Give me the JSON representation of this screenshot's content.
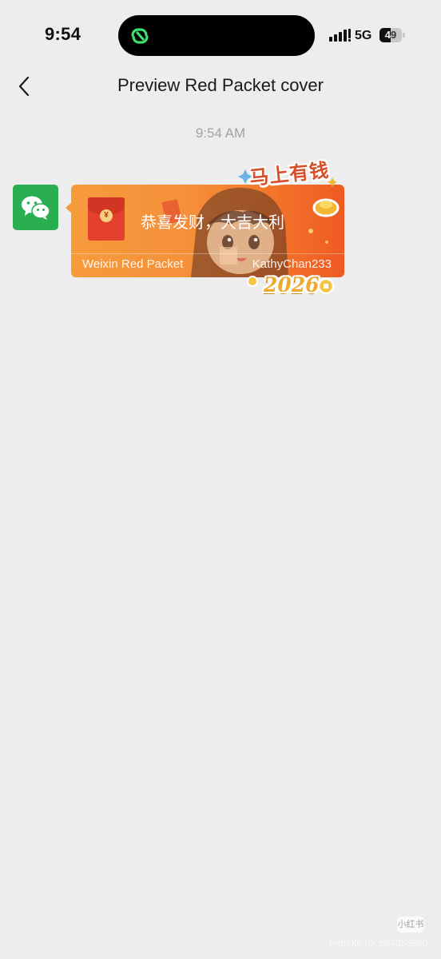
{
  "status_bar": {
    "time": "9:54",
    "network": "5G",
    "battery_percent": 49,
    "battery_label": "49"
  },
  "nav": {
    "back_icon": "chevron-left-icon",
    "title": "Preview Red Packet cover"
  },
  "chat": {
    "timestamp": "9:54 AM",
    "avatar_icon": "wechat-icon",
    "avatar_color": "#2aae52",
    "red_packet": {
      "greeting": "恭喜发财，大吉大利",
      "label": "Weixin Red Packet",
      "sender": "KathyChan233",
      "sticker_top_text": "马上有钱",
      "sticker_year": "2026",
      "colors": {
        "start": "#f79a3c",
        "end": "#ee5a22"
      }
    }
  },
  "watermark": {
    "badge": "小红书",
    "text": "rednote ID: 564358880"
  }
}
